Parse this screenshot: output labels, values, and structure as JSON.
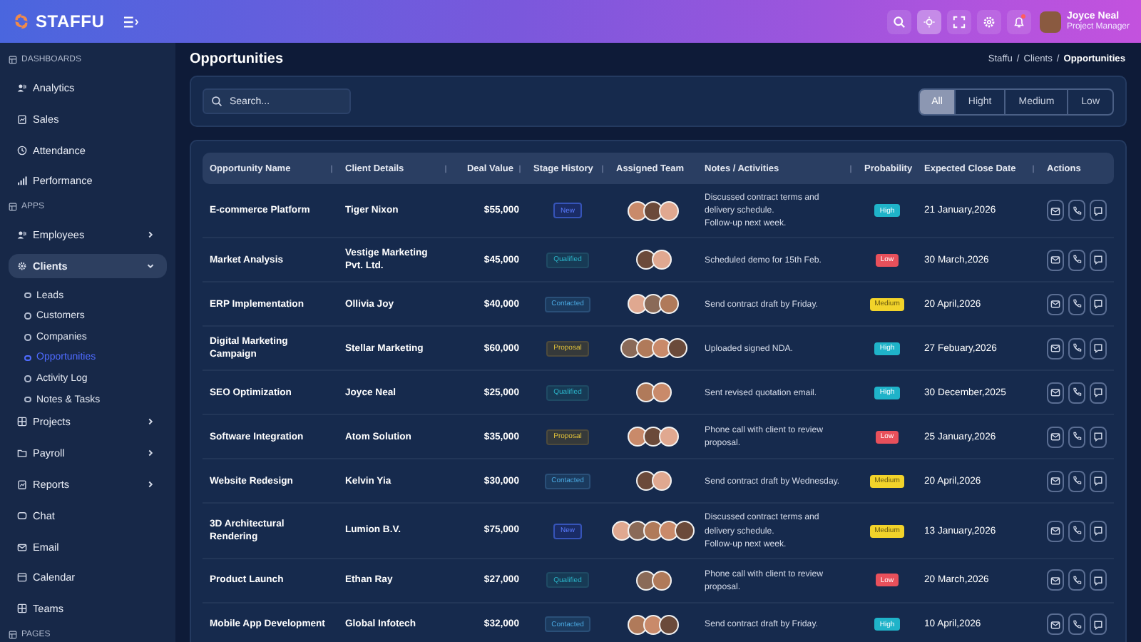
{
  "header": {
    "logo": "STAFFU",
    "user": {
      "name": "Joyce Neal",
      "role": "Project Manager"
    },
    "theme_toggle": {
      "selected": true
    },
    "notifications": {
      "unread": true
    }
  },
  "sidebar": {
    "sections": [
      {
        "title": "DASHBOARDS",
        "items": [
          {
            "label": "Analytics",
            "kind": "link"
          },
          {
            "label": "Sales",
            "kind": "link"
          },
          {
            "label": "Attendance",
            "kind": "link"
          },
          {
            "label": "Performance",
            "kind": "link"
          }
        ]
      },
      {
        "title": "APPS",
        "items": [
          {
            "label": "Employees",
            "kind": "group",
            "expanded": false,
            "selected": false
          },
          {
            "label": "Clients",
            "kind": "group",
            "expanded": true,
            "selected": true,
            "children": [
              {
                "label": "Leads",
                "selected": false
              },
              {
                "label": "Customers",
                "selected": false
              },
              {
                "label": "Companies",
                "selected": false
              },
              {
                "label": "Opportunities",
                "selected": true
              },
              {
                "label": "Activity Log",
                "selected": false
              },
              {
                "label": "Notes & Tasks",
                "selected": false
              }
            ]
          },
          {
            "label": "Projects",
            "kind": "group",
            "expanded": false,
            "selected": false
          },
          {
            "label": "Payroll",
            "kind": "group",
            "expanded": false,
            "selected": false
          },
          {
            "label": "Reports",
            "kind": "group",
            "expanded": false,
            "selected": false
          },
          {
            "label": "Chat",
            "kind": "link"
          },
          {
            "label": "Email",
            "kind": "link"
          },
          {
            "label": "Calendar",
            "kind": "link"
          },
          {
            "label": "Teams",
            "kind": "link"
          }
        ]
      },
      {
        "title": "PAGES"
      }
    ]
  },
  "page": {
    "title": "Opportunities",
    "breadcrumb": [
      {
        "kind": "link",
        "label": "Staffu"
      },
      {
        "kind": "separator",
        "label": "/"
      },
      {
        "kind": "link",
        "label": "Clients"
      },
      {
        "kind": "separator",
        "label": "/"
      },
      {
        "kind": "current",
        "label": "Opportunities"
      }
    ]
  },
  "search": {
    "placeholder": "Search..."
  },
  "filters": [
    {
      "label": "All",
      "selected": true
    },
    {
      "label": "Hight",
      "selected": false
    },
    {
      "label": "Medium",
      "selected": false
    },
    {
      "label": "Low",
      "selected": false
    }
  ],
  "table": {
    "columns": [
      {
        "label": "Opportunity Name",
        "sortable": true
      },
      {
        "label": "Client Details",
        "sortable": true
      },
      {
        "label": "Deal Value",
        "sortable": true
      },
      {
        "label": "Stage History",
        "sortable": true
      },
      {
        "label": "Assigned Team",
        "sortable": false
      },
      {
        "label": "Notes / Activities",
        "sortable": true
      },
      {
        "label": "Probability",
        "sortable": false
      },
      {
        "label": "Expected Close Date",
        "sortable": true
      },
      {
        "label": "Actions",
        "sortable": false
      }
    ],
    "rows": [
      {
        "name": "E-commerce Platform",
        "client": "Tiger Nixon",
        "value": "$55,000",
        "stage": {
          "label": "New",
          "kind": "new"
        },
        "team": [
          {
            "kind": "photo"
          },
          {
            "kind": "photo"
          },
          {
            "kind": "photo"
          }
        ],
        "notes": [
          "Discussed contract terms and delivery schedule.",
          "Follow-up next week."
        ],
        "probability": {
          "label": "High",
          "kind": "high"
        },
        "close_date": "21 January,2026"
      },
      {
        "name": "Market Analysis",
        "client": "Vestige Marketing Pvt. Ltd.",
        "value": "$45,000",
        "stage": {
          "label": "Qualified",
          "kind": "qualified"
        },
        "team": [
          {
            "kind": "photo"
          },
          {
            "kind": "photo"
          }
        ],
        "notes": [
          "Scheduled demo for 15th Feb."
        ],
        "probability": {
          "label": "Low",
          "kind": "low"
        },
        "close_date": "30 March,2026"
      },
      {
        "name": "ERP Implementation",
        "client": "Ollivia Joy",
        "value": "$40,000",
        "stage": {
          "label": "Contacted",
          "kind": "contacted"
        },
        "team": [
          {
            "kind": "photo"
          },
          {
            "kind": "photo"
          },
          {
            "kind": "photo"
          }
        ],
        "notes": [
          "Send contract draft by Friday."
        ],
        "probability": {
          "label": "Medium",
          "kind": "medium"
        },
        "close_date": "20 April,2026"
      },
      {
        "name": "Digital Marketing Campaign",
        "client": "Stellar Marketing",
        "value": "$60,000",
        "stage": {
          "label": "Proposal",
          "kind": "proposal"
        },
        "team": [
          {
            "kind": "photo"
          },
          {
            "kind": "photo"
          },
          {
            "kind": "photo"
          },
          {
            "kind": "photo"
          }
        ],
        "notes": [
          "Uploaded signed NDA."
        ],
        "probability": {
          "label": "High",
          "kind": "high"
        },
        "close_date": "27 Febuary,2026"
      },
      {
        "name": "SEO Optimization",
        "client": "Joyce Neal",
        "value": "$25,000",
        "stage": {
          "label": "Qualified",
          "kind": "qualified"
        },
        "team": [
          {
            "kind": "photo"
          },
          {
            "kind": "photo"
          }
        ],
        "notes": [
          "Sent revised quotation email."
        ],
        "probability": {
          "label": "High",
          "kind": "high"
        },
        "close_date": "30 December,2025"
      },
      {
        "name": "Software Integration",
        "client": "Atom Solution",
        "value": "$35,000",
        "stage": {
          "label": "Proposal",
          "kind": "proposal"
        },
        "team": [
          {
            "kind": "photo"
          },
          {
            "kind": "photo"
          },
          {
            "kind": "photo"
          }
        ],
        "notes": [
          "Phone call with client to review proposal."
        ],
        "probability": {
          "label": "Low",
          "kind": "low"
        },
        "close_date": "25 January,2026"
      },
      {
        "name": "Website Redesign",
        "client": "Kelvin Yia",
        "value": "$30,000",
        "stage": {
          "label": "Contacted",
          "kind": "contacted"
        },
        "team": [
          {
            "kind": "photo"
          },
          {
            "kind": "photo"
          }
        ],
        "notes": [
          "Send contract draft by Wednesday."
        ],
        "probability": {
          "label": "Medium",
          "kind": "medium"
        },
        "close_date": "20 April,2026"
      },
      {
        "name": "3D Architectural Rendering",
        "client": "Lumion B.V.",
        "value": "$75,000",
        "stage": {
          "label": "New",
          "kind": "new"
        },
        "team": [
          {
            "kind": "photo"
          },
          {
            "kind": "photo"
          },
          {
            "kind": "photo"
          },
          {
            "kind": "photo"
          },
          {
            "kind": "photo"
          }
        ],
        "notes": [
          "Discussed contract terms and delivery schedule.",
          "Follow-up next week."
        ],
        "probability": {
          "label": "Medium",
          "kind": "medium"
        },
        "close_date": "13 January,2026"
      },
      {
        "name": "Product Launch",
        "client": "Ethan Ray",
        "value": "$27,000",
        "stage": {
          "label": "Qualified",
          "kind": "qualified"
        },
        "team": [
          {
            "kind": "photo"
          },
          {
            "kind": "photo"
          }
        ],
        "notes": [
          "Phone call with client to review proposal."
        ],
        "probability": {
          "label": "Low",
          "kind": "low"
        },
        "close_date": "20 March,2026"
      },
      {
        "name": "Mobile App Development",
        "client": "Global Infotech",
        "value": "$32,000",
        "stage": {
          "label": "Contacted",
          "kind": "contacted"
        },
        "team": [
          {
            "kind": "photo"
          },
          {
            "kind": "photo"
          },
          {
            "kind": "photo"
          }
        ],
        "notes": [
          "Send contract draft by Friday."
        ],
        "probability": {
          "label": "High",
          "kind": "high"
        },
        "close_date": "10 April,2026"
      }
    ]
  }
}
